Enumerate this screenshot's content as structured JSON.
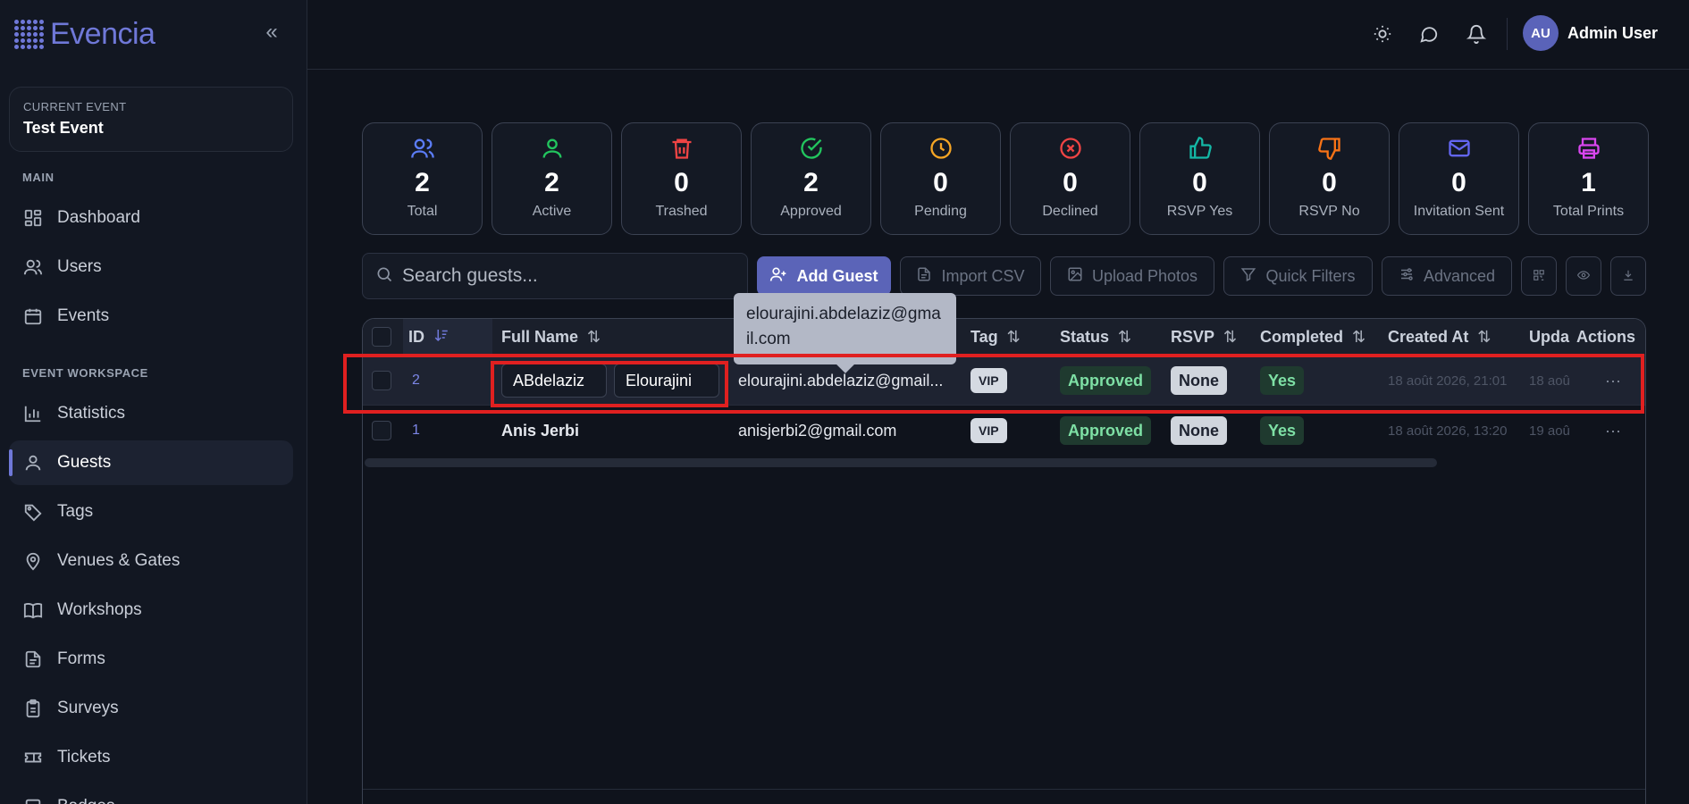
{
  "brand": {
    "name": "Evencia"
  },
  "sidebar": {
    "collapse_label": "«",
    "current_event_label": "CURRENT EVENT",
    "current_event_name": "Test Event",
    "main_title": "MAIN",
    "workspace_title": "EVENT WORKSPACE",
    "main_items": [
      {
        "label": "Dashboard",
        "icon": "dashboard-icon"
      },
      {
        "label": "Users",
        "icon": "users-icon"
      },
      {
        "label": "Events",
        "icon": "calendar-icon"
      }
    ],
    "workspace_items": [
      {
        "label": "Statistics",
        "icon": "bar-chart-icon"
      },
      {
        "label": "Guests",
        "icon": "user-icon",
        "active": true
      },
      {
        "label": "Tags",
        "icon": "tag-icon"
      },
      {
        "label": "Venues & Gates",
        "icon": "map-pin-icon"
      },
      {
        "label": "Workshops",
        "icon": "book-icon"
      },
      {
        "label": "Forms",
        "icon": "file-icon"
      },
      {
        "label": "Surveys",
        "icon": "clipboard-icon"
      },
      {
        "label": "Tickets",
        "icon": "ticket-icon"
      },
      {
        "label": "Badges",
        "icon": "badge-icon"
      }
    ]
  },
  "topbar": {
    "avatar_initials": "AU",
    "user_name": "Admin User"
  },
  "stats": [
    {
      "value": "2",
      "label": "Total",
      "color": "#5b7cf5",
      "icon": "users-icon"
    },
    {
      "value": "2",
      "label": "Active",
      "color": "#22c55e",
      "icon": "user-icon"
    },
    {
      "value": "0",
      "label": "Trashed",
      "color": "#ef4444",
      "icon": "trash-icon"
    },
    {
      "value": "2",
      "label": "Approved",
      "color": "#22c55e",
      "icon": "check-circle-icon"
    },
    {
      "value": "0",
      "label": "Pending",
      "color": "#f5a524",
      "icon": "clock-icon"
    },
    {
      "value": "0",
      "label": "Declined",
      "color": "#ef4444",
      "icon": "x-circle-icon"
    },
    {
      "value": "0",
      "label": "RSVP Yes",
      "color": "#14b8a6",
      "icon": "thumbs-up-icon"
    },
    {
      "value": "0",
      "label": "RSVP No",
      "color": "#f97316",
      "icon": "thumbs-down-icon"
    },
    {
      "value": "0",
      "label": "Invitation Sent",
      "color": "#6366f1",
      "icon": "mail-icon"
    },
    {
      "value": "1",
      "label": "Total Prints",
      "color": "#d946ef",
      "icon": "printer-icon"
    }
  ],
  "toolbar": {
    "search_placeholder": "Search guests...",
    "add_guest": "Add Guest",
    "import_csv": "Import CSV",
    "upload_photos": "Upload Photos",
    "quick_filters": "Quick Filters",
    "advanced": "Advanced"
  },
  "table": {
    "headers": {
      "id": "ID",
      "full_name": "Full Name",
      "tag": "Tag",
      "status": "Status",
      "rsvp": "RSVP",
      "completed": "Completed",
      "created_at": "Created At",
      "updated_at": "Upda",
      "actions": "Actions"
    },
    "rows": [
      {
        "id": "2",
        "first_name": "ABdelaziz",
        "last_name": "Elourajini",
        "email": "elourajini.abdelaziz@gmail...",
        "tag": "VIP",
        "status": "Approved",
        "rsvp": "None",
        "completed": "Yes",
        "created_at": "18 août 2026, 21:01",
        "updated_at": "18 aoû",
        "actions": "···"
      },
      {
        "id": "1",
        "full_name": "Anis Jerbi",
        "email": "anisjerbi2@gmail.com",
        "tag": "VIP",
        "status": "Approved",
        "rsvp": "None",
        "completed": "Yes",
        "created_at": "18 août 2026, 13:20",
        "updated_at": "19 aoû",
        "actions": "···"
      }
    ]
  },
  "tooltip": {
    "text": "elourajini.abdelaziz@gmail.com"
  }
}
